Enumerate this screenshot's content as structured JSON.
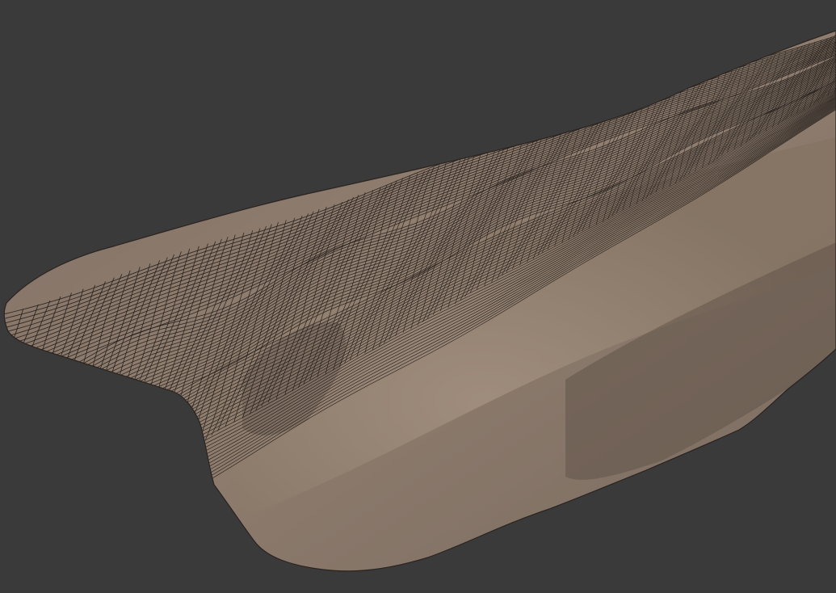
{
  "viewport": {
    "background_color": "#3a3a3a",
    "mesh_fill_color": "#8c7b6d",
    "mesh_highlight_color": "#a08f80",
    "mesh_shadow_color": "#5a4e45",
    "wire_color": "#1e1a18",
    "shading_mode": "smooth-shaded-with-wireframe"
  },
  "model": {
    "kind": "terrain-cliff-mesh",
    "icon": "mesh-icon"
  }
}
